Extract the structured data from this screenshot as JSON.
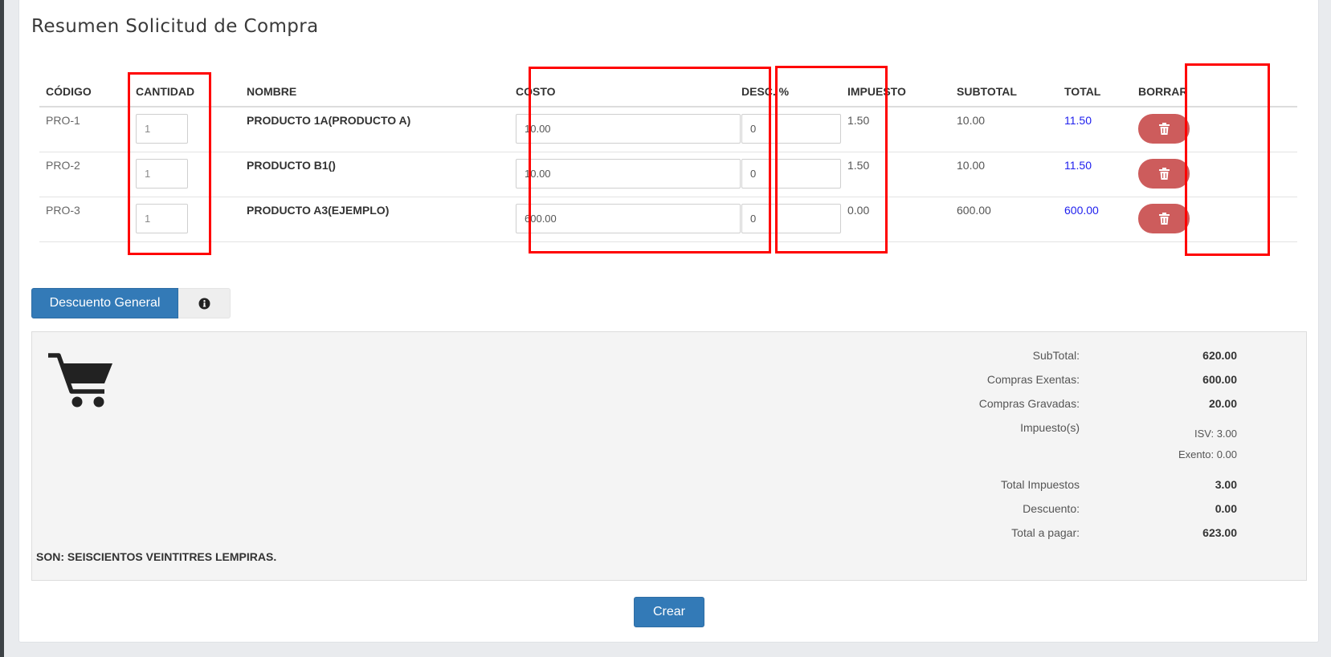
{
  "title": "Resumen Solicitud de Compra",
  "table": {
    "headers": {
      "code": "CÓDIGO",
      "quantity": "CANTIDAD",
      "name": "NOMBRE",
      "cost": "COSTO",
      "discount": "DESC. %",
      "tax": "IMPUESTO",
      "subtotal": "SUBTOTAL",
      "total": "TOTAL",
      "delete": "BORRAR"
    },
    "rows": [
      {
        "code": "PRO-1",
        "quantity": "1",
        "name": "PRODUCTO 1A(PRODUCTO A)",
        "cost": "10.00",
        "discount": "0",
        "tax": "1.50",
        "subtotal": "10.00",
        "total": "11.50"
      },
      {
        "code": "PRO-2",
        "quantity": "1",
        "name": "PRODUCTO B1()",
        "cost": "10.00",
        "discount": "0",
        "tax": "1.50",
        "subtotal": "10.00",
        "total": "11.50"
      },
      {
        "code": "PRO-3",
        "quantity": "1",
        "name": "PRODUCTO A3(EJEMPLO)",
        "cost": "600.00",
        "discount": "0",
        "tax": "0.00",
        "subtotal": "600.00",
        "total": "600.00"
      }
    ]
  },
  "discount_button": "Descuento General",
  "summary": {
    "subtotal_label": "SubTotal:",
    "subtotal_value": "620.00",
    "exempt_label": "Compras Exentas:",
    "exempt_value": "600.00",
    "taxed_label": "Compras Gravadas:",
    "taxed_value": "20.00",
    "taxes_label": "Impuesto(s)",
    "isv_line": "ISV: 3.00",
    "exento_line": "Exento: 0.00",
    "total_taxes_label": "Total Impuestos",
    "total_taxes_value": "3.00",
    "discount_label": "Descuento:",
    "discount_value": "0.00",
    "grand_total_label": "Total a pagar:",
    "grand_total_value": "623.00",
    "amount_in_words": "SON: SEISCIENTOS VEINTITRES LEMPIRAS."
  },
  "create_button": "Crear",
  "icons": {
    "delete": "trash-icon",
    "info": "info-circle-icon",
    "cart": "shopping-cart-icon"
  },
  "colors": {
    "primary": "#337ab7",
    "danger": "#cd5c5c",
    "total_link": "#2020ee",
    "highlight_box": "#ff0000"
  }
}
